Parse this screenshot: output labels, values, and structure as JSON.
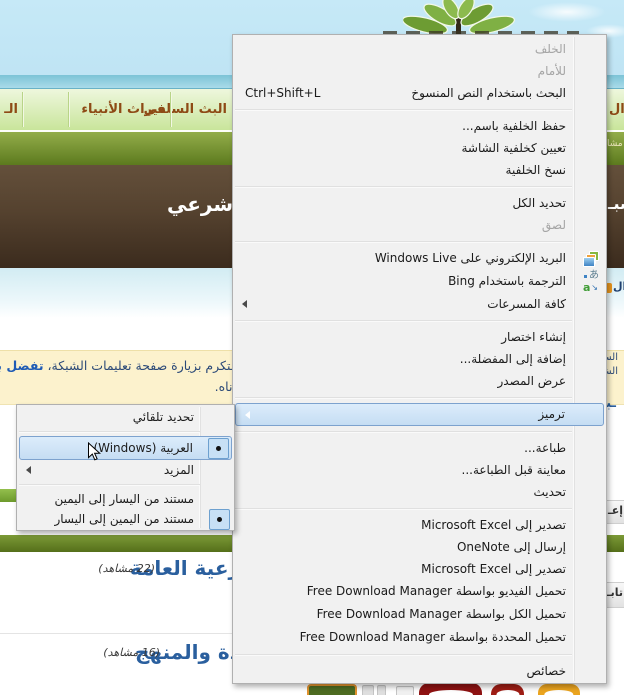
{
  "colors": {
    "menu_bg": "#f1f1f1",
    "menu_border": "#b0b0b0",
    "highlight_fill": "#cde2f7",
    "highlight_border": "#7da2ce",
    "disabled_text": "#a5a5a5",
    "nav_text_brown": "#8e4a15",
    "heading_blue": "#2a5f9e",
    "banner_brown": "#55422f",
    "olive_green": "#5c7a1e",
    "sky_blue": "#c6e9f7",
    "notice_bg": "#fcf2cd"
  },
  "page": {
    "nav_items": [
      {
        "label": "الـ"
      },
      {
        "label": "ميراث الأنبياء"
      },
      {
        "label": "البث السلفي"
      },
      {
        "label": "ال"
      }
    ],
    "olive_right_text": "مشا",
    "banner_text": "شرعي",
    "banner_right_text": "شبـ",
    "cyan_right_text": "ال",
    "blue_fragment": "ـبك",
    "panel_right_1": "إعـ",
    "panel_right_2": "تابـ",
    "notice": {
      "line1_regular": "التكرم بزيارة صفحة تعليمات الشبكة، ",
      "line1_bold": "تفضل بالض",
      "line2": "دناه.",
      "right_line1": "الس",
      "right_line2": "الش"
    },
    "sections": [
      {
        "title": "رعية العامة",
        "views": "(22 مشاهد)"
      },
      {
        "title": "دة والمنهج",
        "views": "(16 مشاهد)"
      }
    ]
  },
  "menu": {
    "items": [
      {
        "label": "الخلف",
        "state": "disabled"
      },
      {
        "label": "للأمام",
        "state": "disabled"
      },
      {
        "label": "البحث باستخدام النص المنسوخ",
        "shortcut": "Ctrl+Shift+L"
      },
      {
        "label": "حفظ الخلفية باسم..."
      },
      {
        "label": "تعيين كخلفية الشاشة"
      },
      {
        "label": "نسخ الخلفية"
      },
      {
        "label": "تحديد الكل"
      },
      {
        "label": "لصق",
        "state": "disabled"
      },
      {
        "label": "البريد الإلكتروني على Windows Live",
        "icon": "windows-live-mail-icon"
      },
      {
        "label": "الترجمة باستخدام Bing",
        "icon": "bing-translate-icon"
      },
      {
        "label": "كافة المسرعات",
        "submenu": true
      },
      {
        "label": "إنشاء اختصار"
      },
      {
        "label": "إضافة إلى المفضلة..."
      },
      {
        "label": "عرض المصدر"
      },
      {
        "label": "ترميز",
        "submenu": true,
        "state": "highlighted"
      },
      {
        "label": "طباعة..."
      },
      {
        "label": "معاينة قبل الطباعة..."
      },
      {
        "label": "تحديث"
      },
      {
        "label": "تصدير إلى Microsoft Excel"
      },
      {
        "label": "إرسال إلى OneNote"
      },
      {
        "label": "تصدير إلى Microsoft Excel"
      },
      {
        "label": "تحميل الفيديو بواسطة Free Download Manager"
      },
      {
        "label": "تحميل الكل بواسطة Free Download Manager"
      },
      {
        "label": "تحميل المحددة بواسطة Free Download Manager"
      },
      {
        "label": "خصائص"
      }
    ]
  },
  "submenu": {
    "items": [
      {
        "label": "تحديد تلقائي"
      },
      {
        "label": "العربية (Windows)",
        "checked": true,
        "state": "highlighted"
      },
      {
        "label": "المزيد",
        "submenu": true
      },
      {
        "label": "مستند من اليسار إلى اليمين"
      },
      {
        "label": "مستند من اليمين إلى اليسار",
        "checked": true
      }
    ]
  }
}
